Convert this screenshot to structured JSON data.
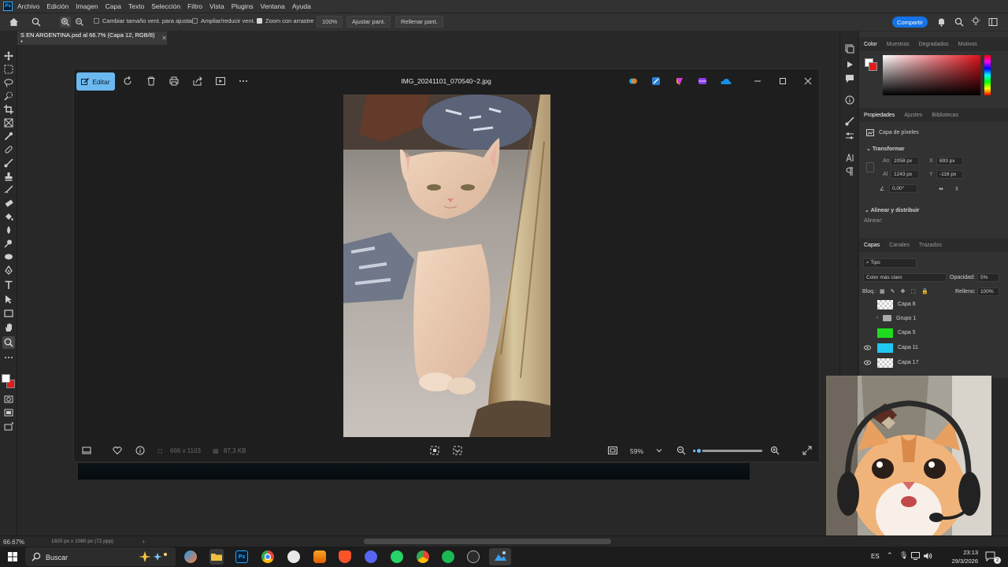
{
  "menubar": {
    "items": [
      "Archivo",
      "Edición",
      "Imagen",
      "Capa",
      "Texto",
      "Selección",
      "Filtro",
      "Vista",
      "Plugins",
      "Ventana",
      "Ayuda"
    ],
    "logo": "Ps"
  },
  "options": {
    "resize_windows": "Cambiar tamaño vent. para ajustar",
    "zoom_all": "Ampliar/reducir vent.",
    "scrubby_zoom": "Zoom con arrastre",
    "zoom_value": "100%",
    "fit_screen": "Ajustar pant.",
    "fill_screen": "Rellenar pant.",
    "share": "Compartir"
  },
  "document": {
    "tab_title": "S EN ARGENTINA.psd al 66.7% (Capa 12, RGB/8) *"
  },
  "viewer": {
    "edit_label": "Editar",
    "file_name": "IMG_20241101_070540~2.jpg",
    "dimensions": "666 x 1103",
    "file_size": "87,3 KB",
    "zoom": "59%",
    "zoom_fraction": 0.08
  },
  "panels": {
    "color_tabs": [
      "Color",
      "Muestras",
      "Degradados",
      "Motivos"
    ],
    "prop_tabs": [
      "Propiedades",
      "Ajustes",
      "Bibliotecas"
    ],
    "layer_type": "Capa de píxeles",
    "transform_label": "Transformar",
    "width_label": "An",
    "width": "2058 px",
    "height_label": "Al",
    "height": "1243 px",
    "x_label": "X",
    "x": "693 px",
    "y_label": "Y",
    "y": "-116 px",
    "angle": "0,00°",
    "align_label": "Alinear y distribuir",
    "align_sub": "Alinear:",
    "layers_tabs": [
      "Capas",
      "Canales",
      "Trazados"
    ],
    "filter_kind": "Tipo",
    "blend_mode": "Color más claro",
    "opacity_label": "Opacidad:",
    "opacity": "5%",
    "lock_label": "Bloq.:",
    "fill_label": "Relleno:",
    "fill": "100%",
    "layers": [
      {
        "name": "Capa 8",
        "thumb": "checker",
        "visible": false
      },
      {
        "name": "Grupo 1",
        "thumb": "folder",
        "visible": false
      },
      {
        "name": "Capa 5",
        "thumb": "#1fdc1f",
        "visible": false
      },
      {
        "name": "Capa 11",
        "thumb": "#1ec8f0",
        "visible": true
      },
      {
        "name": "Capa 17",
        "thumb": "checker",
        "visible": true
      }
    ]
  },
  "status": {
    "zoom": "66.67%",
    "doc_info": "1920 px x 1080 px (72 ppp)"
  },
  "taskbar": {
    "search": "Buscar",
    "lang": "ES",
    "time": "23:13",
    "date": "29/3/2026",
    "notifications": "2"
  },
  "colors": {
    "accent": "#1473e6",
    "edit_button": "#6cb8f0",
    "foreground": "#ffffff",
    "background": "#e01c1c"
  }
}
